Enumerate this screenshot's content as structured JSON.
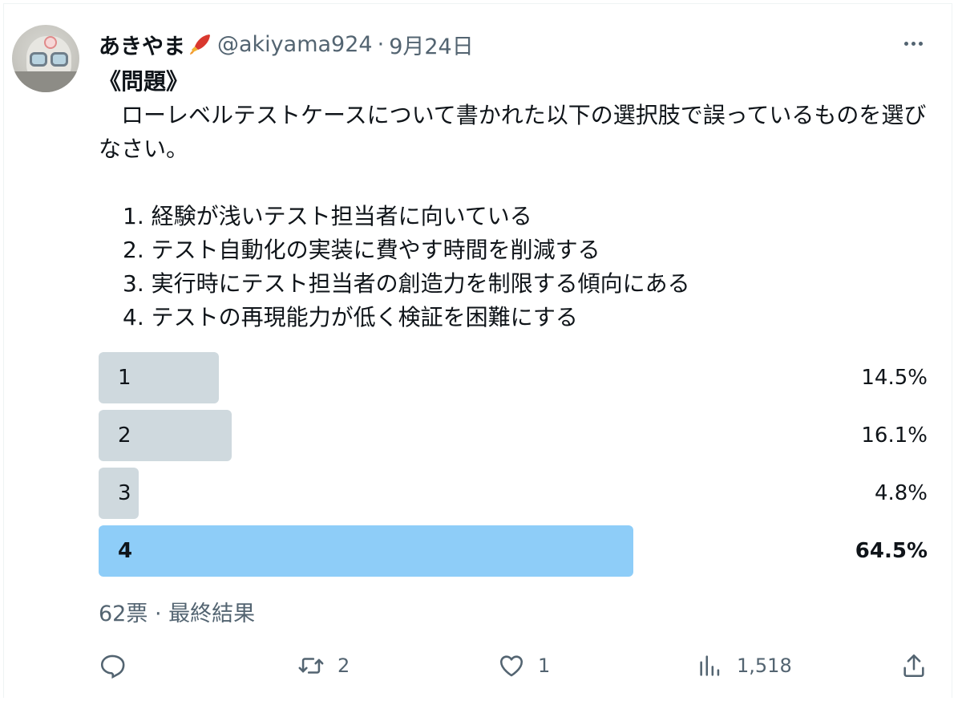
{
  "author": {
    "name": "あきやま",
    "handle": "@akiyama924",
    "separator": "·",
    "date": "9月24日"
  },
  "post": {
    "title": "《問題》",
    "text": "　ローレベルテストケースについて書かれた以下の選択肢で誤っているものを選びなさい。",
    "options": [
      "1. 経験が浅いテスト担当者に向いている",
      "2. テスト自動化の実装に費やす時間を削減する",
      "3. 実行時にテスト担当者の創造力を制限する傾向にある",
      "4. テストの再現能力が低く検証を困難にする"
    ]
  },
  "poll": {
    "choices": [
      {
        "label": "1",
        "percent_text": "14.5%",
        "percent": 14.5,
        "winner": false
      },
      {
        "label": "2",
        "percent_text": "16.1%",
        "percent": 16.1,
        "winner": false
      },
      {
        "label": "3",
        "percent_text": "4.8%",
        "percent": 4.8,
        "winner": false
      },
      {
        "label": "4",
        "percent_text": "64.5%",
        "percent": 64.5,
        "winner": true
      }
    ],
    "meta": "62票 · 最終結果"
  },
  "actions": {
    "reply_icon": "reply-icon",
    "retweet_icon": "retweet-icon",
    "retweet_count": "2",
    "like_icon": "heart-icon",
    "like_count": "1",
    "views_icon": "views-icon",
    "views_count": "1,518",
    "share_icon": "share-icon"
  },
  "colors": {
    "poll_bar": "#cfd9de",
    "poll_bar_winner": "#8ecdf8",
    "secondary_text": "#536471"
  }
}
